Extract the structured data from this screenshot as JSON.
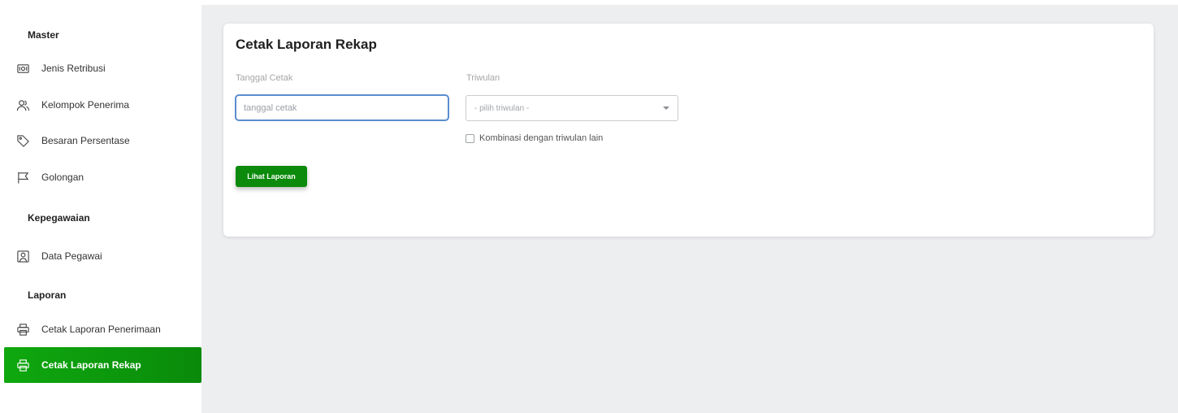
{
  "sidebar": {
    "sections": [
      {
        "title": "Master"
      },
      {
        "title": "Kepegawaian"
      },
      {
        "title": "Laporan"
      }
    ],
    "items": [
      {
        "label": "Jenis Retribusi",
        "icon": "money-icon"
      },
      {
        "label": "Kelompok Penerima",
        "icon": "users-icon"
      },
      {
        "label": "Besaran Persentase",
        "icon": "tag-icon"
      },
      {
        "label": "Golongan",
        "icon": "flag-icon"
      },
      {
        "label": "Data Pegawai",
        "icon": "user-card-icon"
      },
      {
        "label": "Cetak Laporan Penerimaan",
        "icon": "printer-icon"
      },
      {
        "label": "Cetak Laporan Rekap",
        "icon": "printer-icon",
        "active": true
      }
    ]
  },
  "card": {
    "title": "Cetak Laporan Rekap",
    "date_label": "Tanggal Cetak",
    "date_placeholder": "tanggal cetak",
    "quarter_label": "Triwulan",
    "quarter_value": "- pilih triwulan -",
    "combine_label": "Kombinasi dengan triwulan lain",
    "submit_label": "Lihat Laporan"
  },
  "colors": {
    "accent": "#0b8a0b",
    "focus_border": "#5a8dd0",
    "main_bg": "#edeef0"
  }
}
